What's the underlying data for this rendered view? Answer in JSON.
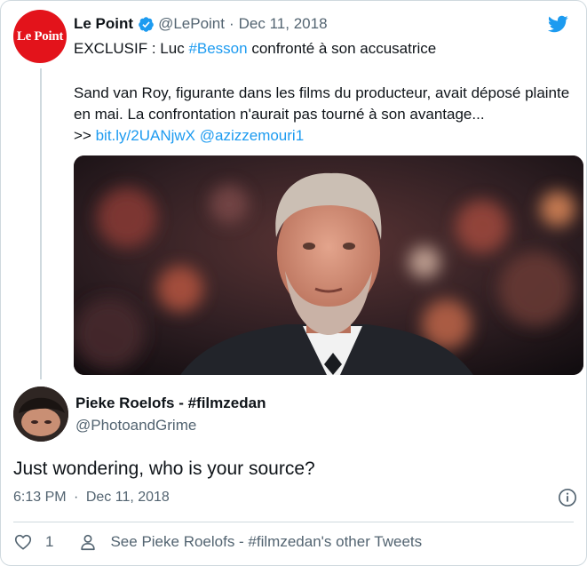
{
  "quoted_tweet": {
    "avatar_text": "Le Point",
    "display_name": "Le Point",
    "handle": "@LePoint",
    "separator": "·",
    "date": "Dec 11, 2018",
    "line1_prefix": "EXCLUSIF : Luc ",
    "hashtag": "#Besson",
    "line1_suffix": " confronté à son accusatrice",
    "body": "Sand van Roy, figurante dans les films du producteur, avait déposé plainte en mai. La confrontation n'aurait pas tourné à son avantage...",
    "link_prefix": ">> ",
    "link": "bit.ly/2UANjwX",
    "mention": "@azizzemouri1"
  },
  "reply_tweet": {
    "display_name": "Pieke Roelofs - #filmzedan",
    "handle": "@PhotoandGrime",
    "text": "Just wondering, who is your source?",
    "time": "6:13 PM",
    "separator": "·",
    "date": "Dec 11, 2018",
    "like_count": "1",
    "see_more_label": "See Pieke Roelofs - #filmzedan's other Tweets"
  },
  "icons": [
    "verified-badge-icon",
    "twitter-bird-icon",
    "info-icon",
    "heart-icon",
    "person-icon"
  ],
  "colors": {
    "accent": "#1d9bf0",
    "le_point_red": "#e3131b",
    "muted": "#536471",
    "border": "#cfd9de"
  }
}
